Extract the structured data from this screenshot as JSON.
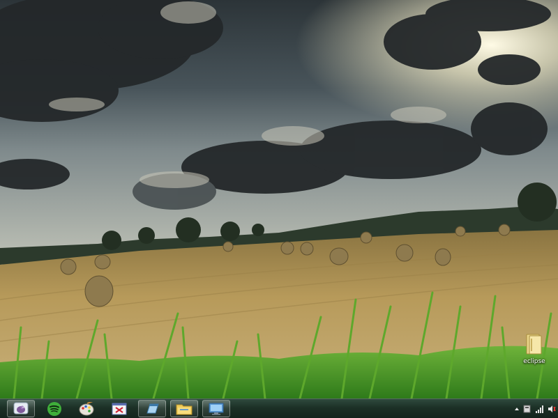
{
  "desktop": {
    "icons": [
      {
        "label": "eclipse",
        "icon": "folder-icon"
      }
    ]
  },
  "taskbar": {
    "buttons": [
      {
        "icon": "pidgin-icon",
        "state": "open"
      },
      {
        "icon": "spotify-icon",
        "state": "pinned"
      },
      {
        "icon": "paint-palette-icon",
        "state": "pinned"
      },
      {
        "icon": "certificate-icon",
        "state": "pinned"
      },
      {
        "icon": "window-app-icon",
        "state": "open"
      },
      {
        "icon": "file-explorer-icon",
        "state": "open"
      },
      {
        "icon": "remote-desktop-icon",
        "state": "open"
      }
    ],
    "tray": [
      {
        "icon": "show-hidden-icons-arrow"
      },
      {
        "icon": "action-center-flag-icon"
      },
      {
        "icon": "network-signal-icon"
      },
      {
        "icon": "volume-icon"
      }
    ]
  },
  "colors": {
    "taskbar": "#1c3026",
    "grass": "#4caf2a",
    "field": "#b89a55",
    "sky": "#5e6a72"
  }
}
